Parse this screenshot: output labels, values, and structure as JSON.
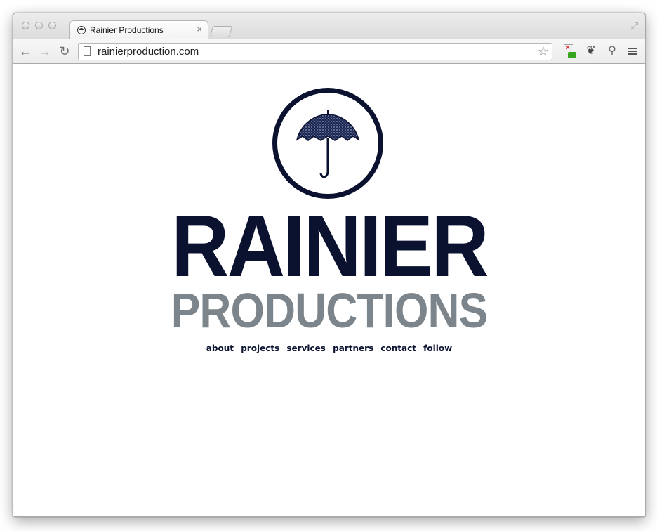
{
  "browser": {
    "tab_title": "Rainier Productions",
    "tab_close": "×",
    "address": "rainierproduction.com",
    "icons": {
      "back": "arrow-left-icon",
      "forward": "arrow-right-icon",
      "reload": "reload-icon",
      "page": "page-icon",
      "bookmark": "star-icon",
      "menu": "hamburger-menu-icon"
    }
  },
  "site": {
    "brand_main": "RAINIER",
    "brand_sub": "PRODUCTIONS",
    "logo": "umbrella-logo",
    "nav": [
      "about",
      "projects",
      "services",
      "partners",
      "contact",
      "follow"
    ],
    "colors": {
      "primary": "#0b1230",
      "secondary": "#7c858b"
    }
  }
}
